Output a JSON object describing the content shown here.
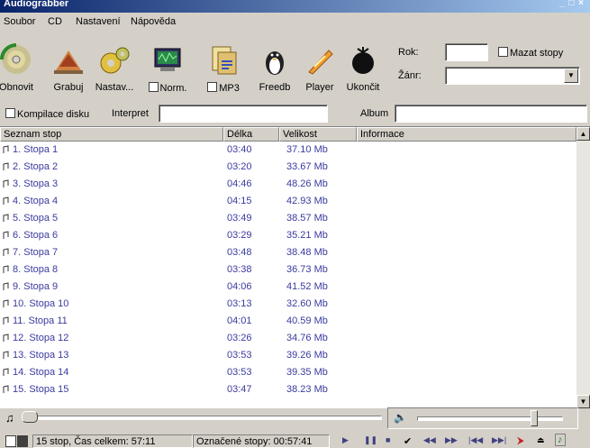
{
  "window": {
    "title": "Audiograbber",
    "controls": "_ □ ×"
  },
  "menu": [
    "Soubor",
    "CD",
    "Nastavení",
    "Nápověda"
  ],
  "toolbar": {
    "buttons": [
      {
        "id": "obnovit",
        "label": "Obnovit",
        "icon": "cd-refresh-icon"
      },
      {
        "id": "grabuj",
        "label": "Grabuj",
        "icon": "grab-icon"
      },
      {
        "id": "nastav",
        "label": "Nastav...",
        "icon": "settings-icon"
      },
      {
        "id": "norm",
        "label": "Norm.",
        "icon": "monitor-icon"
      },
      {
        "id": "mp3",
        "label": "MP3",
        "icon": "mp3-icon"
      },
      {
        "id": "freedb",
        "label": "Freedb",
        "icon": "penguin-icon"
      },
      {
        "id": "player",
        "label": "Player",
        "icon": "player-icon"
      },
      {
        "id": "ukoncit",
        "label": "Ukončit",
        "icon": "bomb-icon"
      }
    ],
    "rok_label": "Rok:",
    "rok_value": "",
    "zanr_label": "Žánr:",
    "zanr_value": "",
    "mazat_label": "Mazat stopy"
  },
  "row2": {
    "kompilace_label": "Kompilace disku",
    "interpret_label": "Interpret",
    "interpret_value": "",
    "album_label": "Album",
    "album_value": ""
  },
  "list": {
    "columns": [
      "Seznam stop",
      "Délka",
      "Velikost",
      "Informace"
    ],
    "rows": [
      {
        "name": "1. Stopa 1",
        "length": "03:40",
        "size": "37.10 Mb"
      },
      {
        "name": "2. Stopa 2",
        "length": "03:20",
        "size": "33.67 Mb"
      },
      {
        "name": "3. Stopa 3",
        "length": "04:46",
        "size": "48.26 Mb"
      },
      {
        "name": "4. Stopa 4",
        "length": "04:15",
        "size": "42.93 Mb"
      },
      {
        "name": "5. Stopa 5",
        "length": "03:49",
        "size": "38.57 Mb"
      },
      {
        "name": "6. Stopa 6",
        "length": "03:29",
        "size": "35.21 Mb"
      },
      {
        "name": "7. Stopa 7",
        "length": "03:48",
        "size": "38.48 Mb"
      },
      {
        "name": "8. Stopa 8",
        "length": "03:38",
        "size": "36.73 Mb"
      },
      {
        "name": "9. Stopa 9",
        "length": "04:06",
        "size": "41.52 Mb"
      },
      {
        "name": "10. Stopa 10",
        "length": "03:13",
        "size": "32.60 Mb"
      },
      {
        "name": "11. Stopa 11",
        "length": "04:01",
        "size": "40.59 Mb"
      },
      {
        "name": "12. Stopa 12",
        "length": "03:26",
        "size": "34.76 Mb"
      },
      {
        "name": "13. Stopa 13",
        "length": "03:53",
        "size": "39.26 Mb"
      },
      {
        "name": "14. Stopa 14",
        "length": "03:53",
        "size": "39.35 Mb"
      },
      {
        "name": "15. Stopa 15",
        "length": "03:47",
        "size": "38.23 Mb"
      }
    ]
  },
  "status": {
    "tracks": "15 stop, Čas celkem: 57:11",
    "selected": "Označené stopy: 00:57:41"
  },
  "colors": {
    "track_text": "#3a3aa0",
    "face": "#d4d0c8"
  }
}
